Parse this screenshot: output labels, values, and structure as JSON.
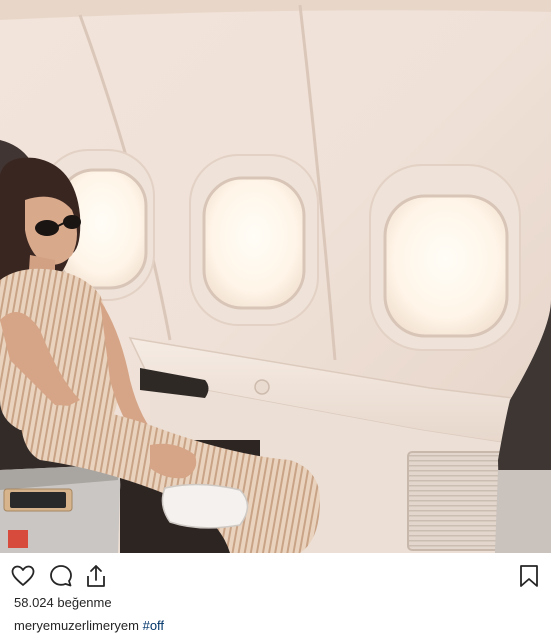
{
  "post": {
    "image_alt": "Woman in striped overalls and sunglasses seated by airplane windows",
    "likes_count": "58.024",
    "likes_label": "beğenme",
    "username": "meryemuzerlimeryem",
    "hashtag": "#off"
  },
  "icons": {
    "like": "heart-icon",
    "comment": "comment-bubble-icon",
    "share": "share-upload-icon",
    "save": "bookmark-icon"
  },
  "colors": {
    "text": "#262626",
    "link": "#003569",
    "cabin_wall": "#efe0d6",
    "window_light": "#fff8ee"
  }
}
